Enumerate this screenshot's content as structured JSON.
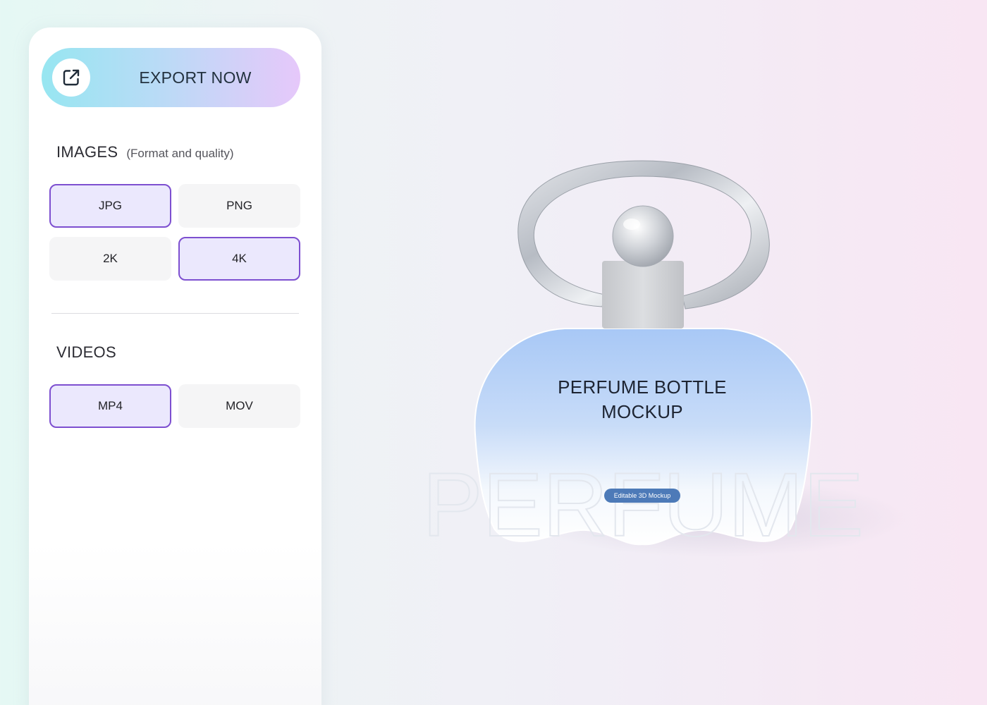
{
  "export": {
    "label": "EXPORT NOW",
    "icon": "external-link-icon"
  },
  "images": {
    "title": "IMAGES",
    "subtitle": "(Format and quality)",
    "options": [
      {
        "label": "JPG",
        "selected": true
      },
      {
        "label": "PNG",
        "selected": false
      },
      {
        "label": "2K",
        "selected": false
      },
      {
        "label": "4K",
        "selected": true
      }
    ]
  },
  "videos": {
    "title": "VIDEOS",
    "options": [
      {
        "label": "MP4",
        "selected": true
      },
      {
        "label": "MOV",
        "selected": false
      }
    ]
  },
  "preview": {
    "title_line1": "PERFUME BOTTLE",
    "title_line2": "MOCKUP",
    "watermark": "PERFUME",
    "badge": "Editable 3D Mockup"
  },
  "colors": {
    "accent": "#7d4fd0",
    "selected_bg": "#ebe8fd",
    "unselected_bg": "#f5f5f6",
    "export_gradient_start": "#97e6f1",
    "export_gradient_end": "#e6c8fa",
    "bottle_top": "#a8c8f6",
    "bottle_bottom": "#ffffff"
  }
}
